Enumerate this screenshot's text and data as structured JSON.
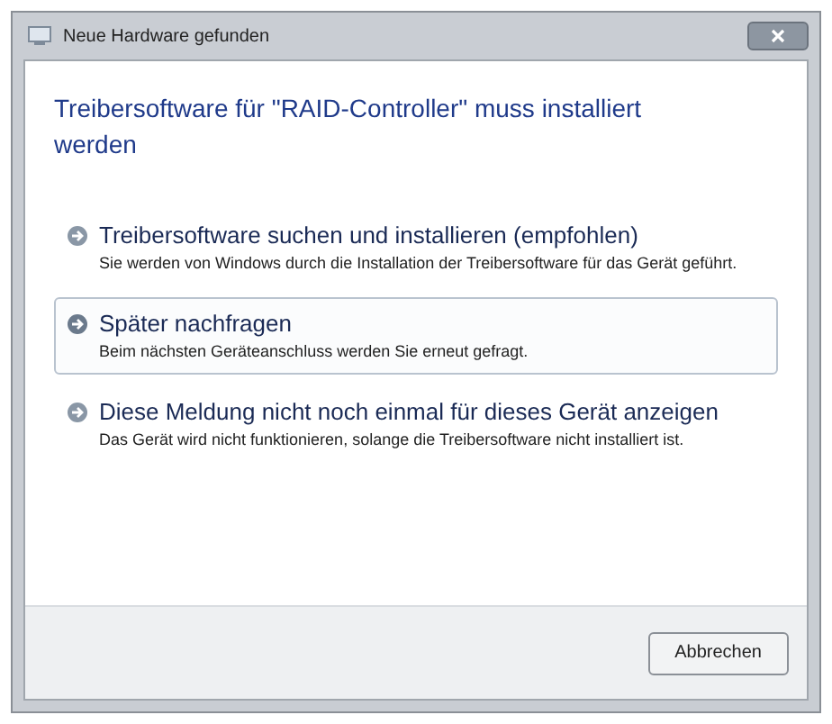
{
  "window": {
    "title": "Neue Hardware gefunden"
  },
  "heading": "Treibersoftware für \"RAID-Controller\" muss installiert werden",
  "options": [
    {
      "title": "Treibersoftware suchen und installieren (empfohlen)",
      "description": "Sie werden von Windows durch die Installation der Treibersoftware für das Gerät geführt.",
      "selected": false
    },
    {
      "title": "Später nachfragen",
      "description": "Beim nächsten Geräteanschluss werden Sie erneut gefragt.",
      "selected": true
    },
    {
      "title": "Diese Meldung nicht noch einmal für dieses Gerät anzeigen",
      "description": "Das Gerät wird nicht funktionieren, solange die Treibersoftware nicht installiert ist.",
      "selected": false
    }
  ],
  "buttons": [
    "Abbrechen"
  ]
}
